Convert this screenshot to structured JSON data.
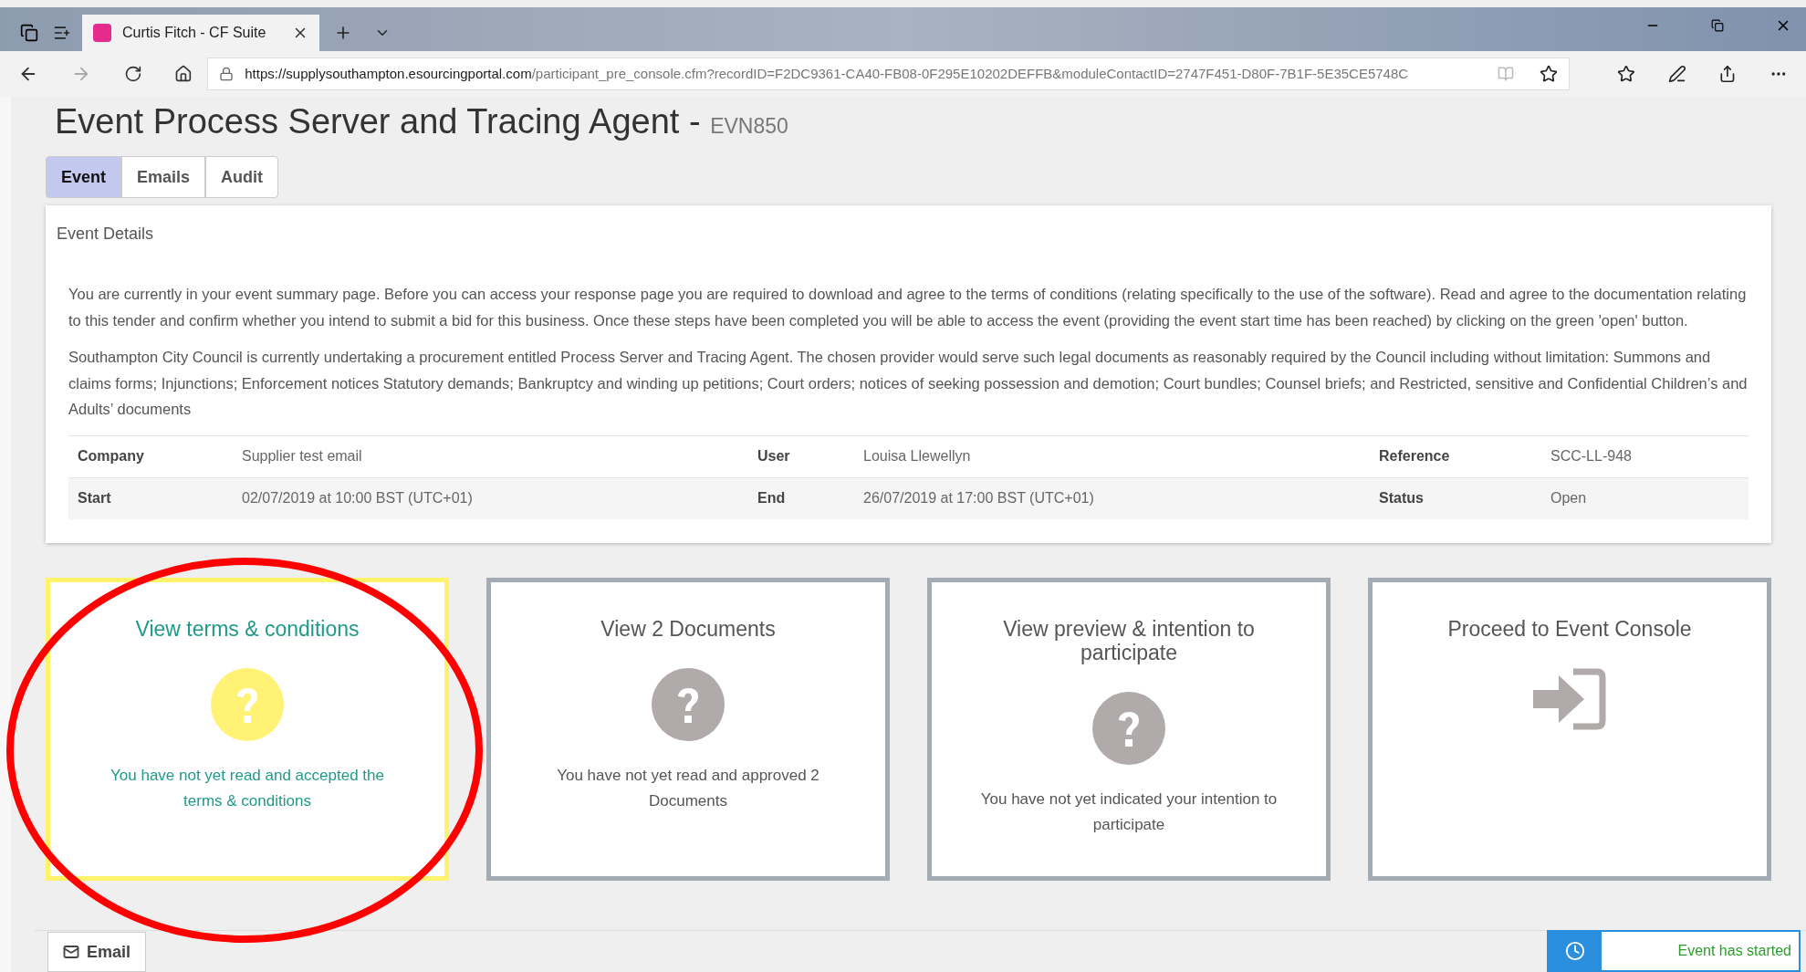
{
  "browser": {
    "tab_title": "Curtis Fitch - CF Suite",
    "url_host": "https://supplysouthampton.esourcingportal.com",
    "url_path": "/participant_pre_console.cfm?recordID=F2DC9361-CA40-FB08-0F295E10202DEFFB&moduleContactID=2747F451-D80F-7B1F-5E35CE5748C"
  },
  "page": {
    "title": "Event Process Server and Tracing Agent - ",
    "code": "EVN850"
  },
  "tabs": [
    {
      "label": "Event",
      "selected": true
    },
    {
      "label": "Emails",
      "selected": false
    },
    {
      "label": "Audit",
      "selected": false
    }
  ],
  "details": {
    "heading": "Event Details",
    "paragraphs": [
      "You are currently in your event summary page. Before you can access your response page you are required to download and agree to the terms of conditions (relating specifically to the use of the software). Read and agree to the documentation relating to this tender and confirm whether you intend to submit a bid for this business. Once these steps have been completed you will be able to access the event (providing the event start time has been reached) by clicking on the green 'open' button.",
      "Southampton City Council is currently undertaking a procurement entitled Process Server and Tracing Agent. The chosen provider would serve such legal documents as reasonably required by the Council including without limitation: Summons and claims forms; Injunctions; Enforcement notices Statutory demands; Bankruptcy and winding up petitions; Court orders; notices of seeking possession and demotion; Court bundles; Counsel briefs; and Restricted, sensitive and Confidential Children’s and Adults’ documents"
    ],
    "rows": [
      [
        {
          "label": "Company",
          "value": "Supplier test email"
        },
        {
          "label": "User",
          "value": "Louisa Llewellyn"
        },
        {
          "label": "Reference",
          "value": "SCC-LL-948"
        }
      ],
      [
        {
          "label": "Start",
          "value": "02/07/2019 at 10:00 BST (UTC+01)"
        },
        {
          "label": "End",
          "value": "26/07/2019 at 17:00 BST (UTC+01)"
        },
        {
          "label": "Status",
          "value": "Open"
        }
      ]
    ]
  },
  "steps": [
    {
      "kind": "question",
      "highlighted": true,
      "title": "View terms & conditions",
      "message": "You have not yet read and accepted the terms & conditions"
    },
    {
      "kind": "question",
      "highlighted": false,
      "title": "View 2 Documents",
      "message": "You have not yet read and approved 2 Documents"
    },
    {
      "kind": "question",
      "highlighted": false,
      "title": "View preview & intention to participate",
      "message": "You have not yet indicated your intention to participate"
    },
    {
      "kind": "proceed",
      "highlighted": false,
      "title": "Proceed to Event Console"
    }
  ],
  "footer": {
    "email_button": "Email",
    "notice": "Event has started"
  }
}
